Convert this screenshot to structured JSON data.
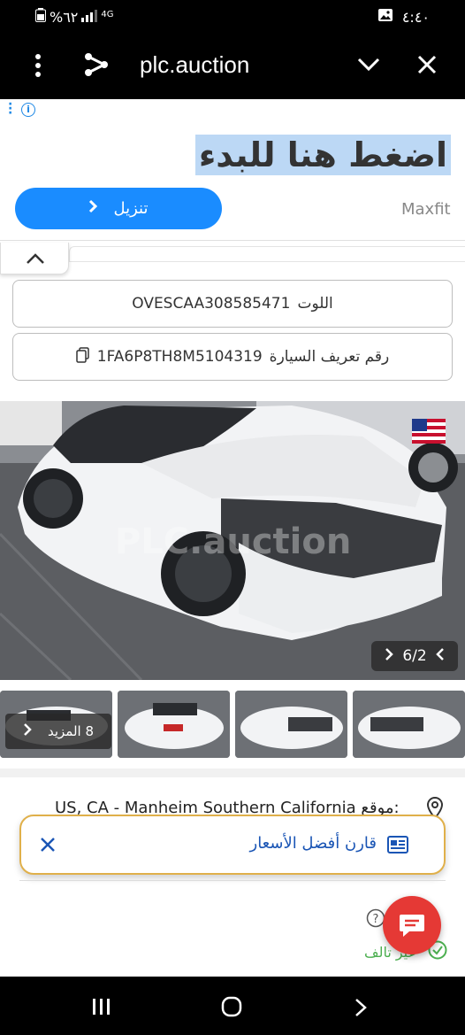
{
  "status_bar": {
    "battery_text": "%٦٢",
    "network": "4G",
    "time": "٤:٤٠"
  },
  "browser": {
    "url": "plc.auction"
  },
  "ad": {
    "headline": "اضغط هنا للبدء",
    "button_label": "تنزيل",
    "brand": "Maxfit"
  },
  "vehicle": {
    "color_label": "اللوت",
    "color_value": "OVESCAA308585471",
    "vin_label": "رقم تعريف السيارة",
    "vin_value": "1FA6P8TH8M5104319"
  },
  "gallery": {
    "counter": "6/2",
    "more_label": "8 المزيد",
    "watermark": "PLC.auction"
  },
  "location": {
    "label": "موقع:",
    "value": "US, CA - Manheim Southern California"
  },
  "compare": {
    "label": "قارن أفضل الأسعار"
  },
  "condition": {
    "label": "غير تالف"
  },
  "colors": {
    "accent_blue": "#1a8cff",
    "link_blue": "#1a55b5",
    "chat_red": "#e53935",
    "ok_green": "#4caf50"
  }
}
